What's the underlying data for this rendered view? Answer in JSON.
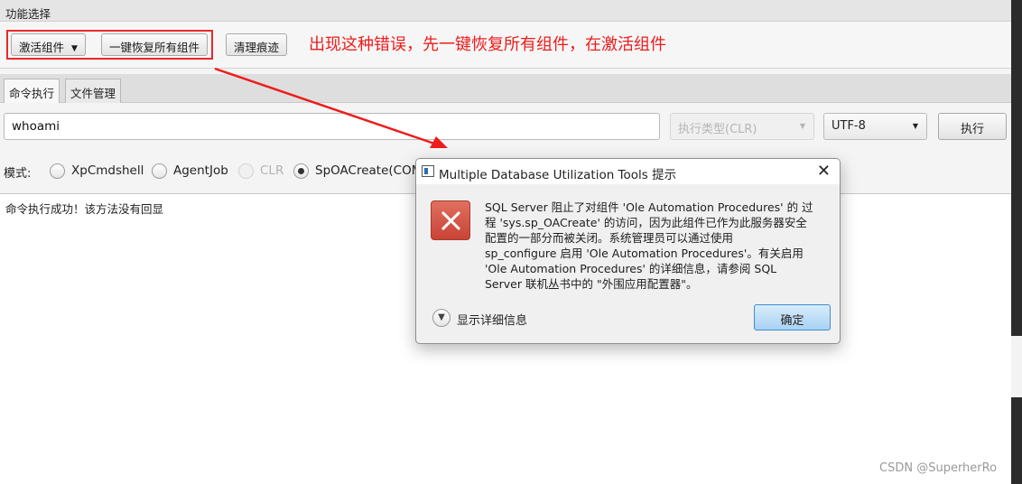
{
  "section": {
    "title": "功能选择"
  },
  "toolbar": {
    "activate_label": "激活组件",
    "restore_label": "一键恢复所有组件",
    "clean_label": "清理痕迹"
  },
  "annotation": {
    "text": "出现这种错误，先一键恢复所有组件，在激活组件",
    "color": "#ee1c1c"
  },
  "tabs": [
    {
      "label": "命令执行",
      "active": true
    },
    {
      "label": "文件管理",
      "active": false
    }
  ],
  "command": {
    "value": "whoami",
    "exec_type": "执行类型(CLR)",
    "encoding": "UTF-8",
    "exec_label": "执行"
  },
  "mode": {
    "label": "模式:",
    "options": [
      {
        "label": "XpCmdshell",
        "checked": false,
        "disabled": false
      },
      {
        "label": "AgentJob",
        "checked": false,
        "disabled": false
      },
      {
        "label": "CLR",
        "checked": false,
        "disabled": true
      },
      {
        "label": "SpOACreate(COM",
        "checked": true,
        "disabled": false
      }
    ]
  },
  "output": {
    "text": "命令执行成功！该方法没有回显"
  },
  "dialog": {
    "title": "Multiple Database Utilization Tools 提示",
    "message_lines": [
      "SQL Server 阻止了对组件 'Ole Automation Procedures' 的 过",
      "程 'sys.sp_OACreate' 的访问，因为此组件已作为此服务器安全",
      "配置的一部分而被关闭。系统管理员可以通过使用",
      "sp_configure 启用 'Ole Automation Procedures'。有关启用",
      "'Ole Automation Procedures' 的详细信息，请参阅 SQL",
      "Server 联机丛书中的 \"外围应用配置器\"。"
    ],
    "details_label": "显示详细信息",
    "ok_label": "确定",
    "error_icon": "error-x-icon",
    "close_icon": "close-icon"
  },
  "watermark": {
    "text": "CSDN @SuperherRo"
  }
}
